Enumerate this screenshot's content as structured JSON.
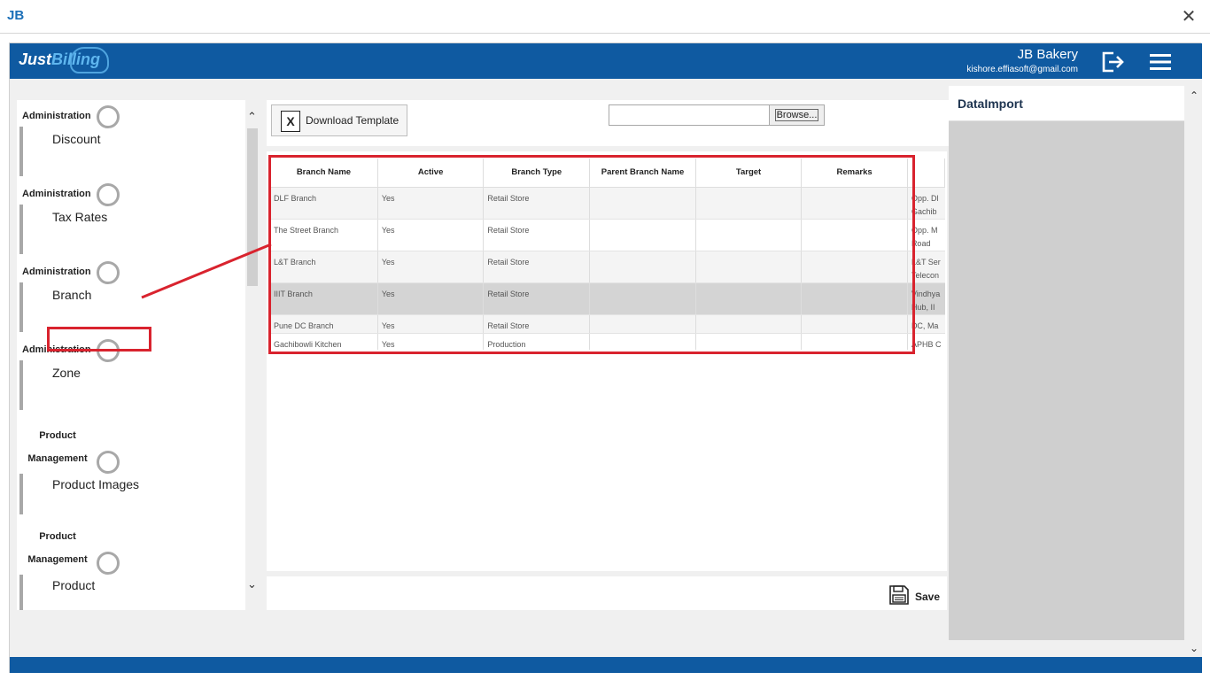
{
  "window": {
    "logo_text": "JB",
    "close_glyph": "✕"
  },
  "header": {
    "brand_part1": "Just",
    "brand_part2": "Billing",
    "company_name": "JB Bakery",
    "email": "kishore.effiasoft@gmail.com",
    "icons": [
      "logout-icon",
      "hamburger-menu-icon"
    ]
  },
  "steps": [
    {
      "category": "Administration",
      "name": "Discount",
      "two_line": false
    },
    {
      "category": "Administration",
      "name": "Tax Rates",
      "two_line": false
    },
    {
      "category": "Administration",
      "name": "Branch",
      "two_line": false,
      "highlighted": true
    },
    {
      "category": "Administration",
      "name": "Zone",
      "two_line": false
    },
    {
      "category_line1": "Product",
      "category_line2": "Management",
      "name": "Product Images",
      "two_line": true
    },
    {
      "category_line1": "Product",
      "category_line2": "Management",
      "name": "Product",
      "two_line": true
    }
  ],
  "toolbar": {
    "download_label": "Download Template",
    "excel_icon_letter": "X",
    "file_value": "",
    "browse_label": "Browse..."
  },
  "grid": {
    "columns": [
      "Branch Name",
      "Active",
      "Branch Type",
      "Parent Branch Name",
      "Target",
      "Remarks",
      ""
    ],
    "rows": [
      {
        "cells": [
          "DLF Branch",
          "Yes",
          "Retail Store",
          "",
          "",
          "",
          "Opp. Dl\nGachib"
        ],
        "state": "alt"
      },
      {
        "cells": [
          "The Street Branch",
          "Yes",
          "Retail Store",
          "",
          "",
          "",
          "Opp. M\nRoad"
        ],
        "state": ""
      },
      {
        "cells": [
          "L&T Branch",
          "Yes",
          "Retail Store",
          "",
          "",
          "",
          "L&T Ser\nTelecon"
        ],
        "state": "alt"
      },
      {
        "cells": [
          "IIIT Branch",
          "Yes",
          "Retail Store",
          "",
          "",
          "",
          "Vindhya\nHub, II"
        ],
        "state": "sel"
      },
      {
        "cells": [
          "Pune DC Branch",
          "Yes",
          "Retail Store",
          "",
          "",
          "",
          "DC, Ma"
        ],
        "state": "alt"
      },
      {
        "cells": [
          "Gachibowli Kitchen",
          "Yes",
          "Production",
          "",
          "",
          "",
          "APHB C"
        ],
        "state": ""
      }
    ]
  },
  "save": {
    "label": "Save"
  },
  "right_panel": {
    "title": "DataImport"
  },
  "colors": {
    "header_blue": "#0f5aa1",
    "highlight_red": "#d9232e",
    "selected_row": "#d4d4d4"
  }
}
